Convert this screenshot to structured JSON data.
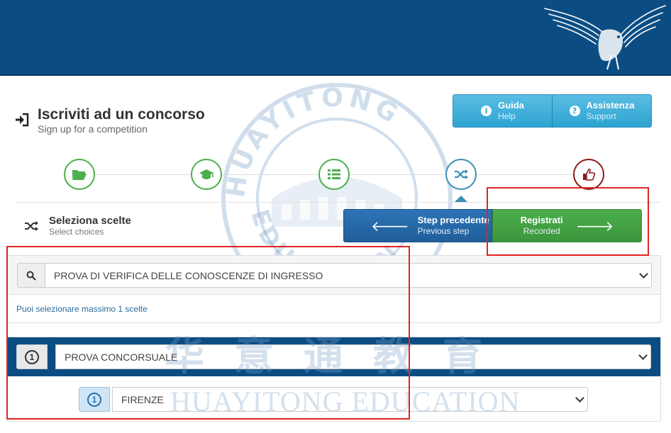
{
  "header": {
    "logo_icon": "eagle-icon"
  },
  "page": {
    "title": "Iscriviti ad un concorso",
    "subtitle": "Sign up for a competition"
  },
  "help": {
    "guide_label": "Guida",
    "guide_sub": "Help",
    "support_label": "Assistenza",
    "support_sub": "Support"
  },
  "steps": [
    {
      "icon": "folder-open-icon",
      "state": "done"
    },
    {
      "icon": "graduation-cap-icon",
      "state": "done"
    },
    {
      "icon": "list-icon",
      "state": "done"
    },
    {
      "icon": "shuffle-icon",
      "state": "current"
    },
    {
      "icon": "thumbs-up-icon",
      "state": "final"
    }
  ],
  "section": {
    "title": "Seleziona scelte",
    "subtitle": "Select choices"
  },
  "nav": {
    "prev_label": "Step precedente",
    "prev_sub": "Previous step",
    "next_label": "Registrati",
    "next_sub": "Recorded"
  },
  "selection": {
    "test_value": "PROVA DI VERIFICA DELLE CONOSCENZE DI INGRESSO",
    "hint": "Puoi selezionare massimo 1 scelte"
  },
  "choice": {
    "number": "1",
    "exam_value": "PROVA CONCORSUALE",
    "city_number": "1",
    "city_value": "FIRENZE"
  },
  "watermark": {
    "cn": "华意通教育",
    "en": "HUAYITONG EDUCATION",
    "ring_top": "HUAYITONG",
    "ring_bottom": "EDUCATION"
  },
  "colors": {
    "header": "#0b4d83",
    "accent_green": "#4cae4c",
    "accent_blue": "#2ea4d1",
    "annotation_red": "#e02424"
  }
}
